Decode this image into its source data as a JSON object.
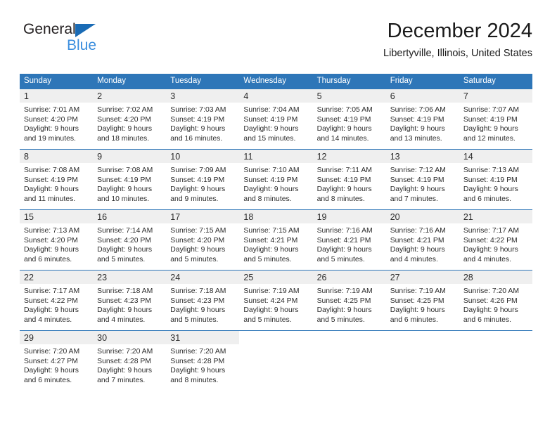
{
  "brand": {
    "name_top": "General",
    "name_bottom": "Blue",
    "accent_color": "#2e76b8",
    "logo_blue": "#3b8ede"
  },
  "header": {
    "title": "December 2024",
    "subtitle": "Libertyville, Illinois, United States"
  },
  "calendar": {
    "weekday_headers": [
      "Sunday",
      "Monday",
      "Tuesday",
      "Wednesday",
      "Thursday",
      "Friday",
      "Saturday"
    ],
    "header_bg": "#2e76b8",
    "daynum_band_bg": "#efefef",
    "weeks": [
      [
        {
          "day": "1",
          "sunrise": "Sunrise: 7:01 AM",
          "sunset": "Sunset: 4:20 PM",
          "daylight_line1": "Daylight: 9 hours",
          "daylight_line2": "and 19 minutes."
        },
        {
          "day": "2",
          "sunrise": "Sunrise: 7:02 AM",
          "sunset": "Sunset: 4:20 PM",
          "daylight_line1": "Daylight: 9 hours",
          "daylight_line2": "and 18 minutes."
        },
        {
          "day": "3",
          "sunrise": "Sunrise: 7:03 AM",
          "sunset": "Sunset: 4:19 PM",
          "daylight_line1": "Daylight: 9 hours",
          "daylight_line2": "and 16 minutes."
        },
        {
          "day": "4",
          "sunrise": "Sunrise: 7:04 AM",
          "sunset": "Sunset: 4:19 PM",
          "daylight_line1": "Daylight: 9 hours",
          "daylight_line2": "and 15 minutes."
        },
        {
          "day": "5",
          "sunrise": "Sunrise: 7:05 AM",
          "sunset": "Sunset: 4:19 PM",
          "daylight_line1": "Daylight: 9 hours",
          "daylight_line2": "and 14 minutes."
        },
        {
          "day": "6",
          "sunrise": "Sunrise: 7:06 AM",
          "sunset": "Sunset: 4:19 PM",
          "daylight_line1": "Daylight: 9 hours",
          "daylight_line2": "and 13 minutes."
        },
        {
          "day": "7",
          "sunrise": "Sunrise: 7:07 AM",
          "sunset": "Sunset: 4:19 PM",
          "daylight_line1": "Daylight: 9 hours",
          "daylight_line2": "and 12 minutes."
        }
      ],
      [
        {
          "day": "8",
          "sunrise": "Sunrise: 7:08 AM",
          "sunset": "Sunset: 4:19 PM",
          "daylight_line1": "Daylight: 9 hours",
          "daylight_line2": "and 11 minutes."
        },
        {
          "day": "9",
          "sunrise": "Sunrise: 7:08 AM",
          "sunset": "Sunset: 4:19 PM",
          "daylight_line1": "Daylight: 9 hours",
          "daylight_line2": "and 10 minutes."
        },
        {
          "day": "10",
          "sunrise": "Sunrise: 7:09 AM",
          "sunset": "Sunset: 4:19 PM",
          "daylight_line1": "Daylight: 9 hours",
          "daylight_line2": "and 9 minutes."
        },
        {
          "day": "11",
          "sunrise": "Sunrise: 7:10 AM",
          "sunset": "Sunset: 4:19 PM",
          "daylight_line1": "Daylight: 9 hours",
          "daylight_line2": "and 8 minutes."
        },
        {
          "day": "12",
          "sunrise": "Sunrise: 7:11 AM",
          "sunset": "Sunset: 4:19 PM",
          "daylight_line1": "Daylight: 9 hours",
          "daylight_line2": "and 8 minutes."
        },
        {
          "day": "13",
          "sunrise": "Sunrise: 7:12 AM",
          "sunset": "Sunset: 4:19 PM",
          "daylight_line1": "Daylight: 9 hours",
          "daylight_line2": "and 7 minutes."
        },
        {
          "day": "14",
          "sunrise": "Sunrise: 7:13 AM",
          "sunset": "Sunset: 4:19 PM",
          "daylight_line1": "Daylight: 9 hours",
          "daylight_line2": "and 6 minutes."
        }
      ],
      [
        {
          "day": "15",
          "sunrise": "Sunrise: 7:13 AM",
          "sunset": "Sunset: 4:20 PM",
          "daylight_line1": "Daylight: 9 hours",
          "daylight_line2": "and 6 minutes."
        },
        {
          "day": "16",
          "sunrise": "Sunrise: 7:14 AM",
          "sunset": "Sunset: 4:20 PM",
          "daylight_line1": "Daylight: 9 hours",
          "daylight_line2": "and 5 minutes."
        },
        {
          "day": "17",
          "sunrise": "Sunrise: 7:15 AM",
          "sunset": "Sunset: 4:20 PM",
          "daylight_line1": "Daylight: 9 hours",
          "daylight_line2": "and 5 minutes."
        },
        {
          "day": "18",
          "sunrise": "Sunrise: 7:15 AM",
          "sunset": "Sunset: 4:21 PM",
          "daylight_line1": "Daylight: 9 hours",
          "daylight_line2": "and 5 minutes."
        },
        {
          "day": "19",
          "sunrise": "Sunrise: 7:16 AM",
          "sunset": "Sunset: 4:21 PM",
          "daylight_line1": "Daylight: 9 hours",
          "daylight_line2": "and 5 minutes."
        },
        {
          "day": "20",
          "sunrise": "Sunrise: 7:16 AM",
          "sunset": "Sunset: 4:21 PM",
          "daylight_line1": "Daylight: 9 hours",
          "daylight_line2": "and 4 minutes."
        },
        {
          "day": "21",
          "sunrise": "Sunrise: 7:17 AM",
          "sunset": "Sunset: 4:22 PM",
          "daylight_line1": "Daylight: 9 hours",
          "daylight_line2": "and 4 minutes."
        }
      ],
      [
        {
          "day": "22",
          "sunrise": "Sunrise: 7:17 AM",
          "sunset": "Sunset: 4:22 PM",
          "daylight_line1": "Daylight: 9 hours",
          "daylight_line2": "and 4 minutes."
        },
        {
          "day": "23",
          "sunrise": "Sunrise: 7:18 AM",
          "sunset": "Sunset: 4:23 PM",
          "daylight_line1": "Daylight: 9 hours",
          "daylight_line2": "and 4 minutes."
        },
        {
          "day": "24",
          "sunrise": "Sunrise: 7:18 AM",
          "sunset": "Sunset: 4:23 PM",
          "daylight_line1": "Daylight: 9 hours",
          "daylight_line2": "and 5 minutes."
        },
        {
          "day": "25",
          "sunrise": "Sunrise: 7:19 AM",
          "sunset": "Sunset: 4:24 PM",
          "daylight_line1": "Daylight: 9 hours",
          "daylight_line2": "and 5 minutes."
        },
        {
          "day": "26",
          "sunrise": "Sunrise: 7:19 AM",
          "sunset": "Sunset: 4:25 PM",
          "daylight_line1": "Daylight: 9 hours",
          "daylight_line2": "and 5 minutes."
        },
        {
          "day": "27",
          "sunrise": "Sunrise: 7:19 AM",
          "sunset": "Sunset: 4:25 PM",
          "daylight_line1": "Daylight: 9 hours",
          "daylight_line2": "and 6 minutes."
        },
        {
          "day": "28",
          "sunrise": "Sunrise: 7:20 AM",
          "sunset": "Sunset: 4:26 PM",
          "daylight_line1": "Daylight: 9 hours",
          "daylight_line2": "and 6 minutes."
        }
      ],
      [
        {
          "day": "29",
          "sunrise": "Sunrise: 7:20 AM",
          "sunset": "Sunset: 4:27 PM",
          "daylight_line1": "Daylight: 9 hours",
          "daylight_line2": "and 6 minutes."
        },
        {
          "day": "30",
          "sunrise": "Sunrise: 7:20 AM",
          "sunset": "Sunset: 4:28 PM",
          "daylight_line1": "Daylight: 9 hours",
          "daylight_line2": "and 7 minutes."
        },
        {
          "day": "31",
          "sunrise": "Sunrise: 7:20 AM",
          "sunset": "Sunset: 4:28 PM",
          "daylight_line1": "Daylight: 9 hours",
          "daylight_line2": "and 8 minutes."
        },
        {
          "day": "",
          "sunrise": "",
          "sunset": "",
          "daylight_line1": "",
          "daylight_line2": ""
        },
        {
          "day": "",
          "sunrise": "",
          "sunset": "",
          "daylight_line1": "",
          "daylight_line2": ""
        },
        {
          "day": "",
          "sunrise": "",
          "sunset": "",
          "daylight_line1": "",
          "daylight_line2": ""
        },
        {
          "day": "",
          "sunrise": "",
          "sunset": "",
          "daylight_line1": "",
          "daylight_line2": ""
        }
      ]
    ]
  }
}
